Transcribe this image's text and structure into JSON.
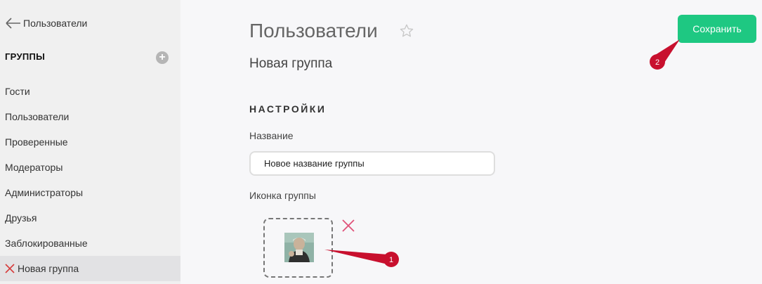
{
  "sidebar": {
    "back_label": "Пользователи",
    "groups_title": "ГРУППЫ",
    "add_symbol": "+",
    "items": [
      {
        "label": "Гости"
      },
      {
        "label": "Пользователи"
      },
      {
        "label": "Проверенные"
      },
      {
        "label": "Модераторы"
      },
      {
        "label": "Администраторы"
      },
      {
        "label": "Друзья"
      },
      {
        "label": "Заблокированные"
      },
      {
        "label": "Новая группа",
        "active": true
      }
    ]
  },
  "header": {
    "title": "Пользователи",
    "subtitle": "Новая группа",
    "save_label": "Сохранить"
  },
  "form": {
    "section_title": "НАСТРОЙКИ",
    "name_label": "Название",
    "name_value": "Новое название группы",
    "icon_label": "Иконка группы"
  },
  "annotations": [
    {
      "number": "1"
    },
    {
      "number": "2"
    }
  ],
  "colors": {
    "accent": "#1ec882",
    "annotation": "#c8102e",
    "remove": "#e0527a"
  }
}
